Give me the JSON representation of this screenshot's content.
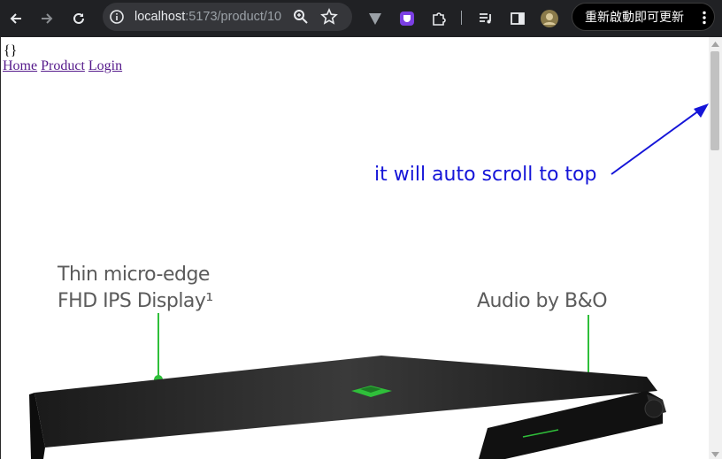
{
  "browser": {
    "url_host": "localhost",
    "url_path": ":5173/product/10",
    "update_button_label": "重新啟動即可更新",
    "icons": [
      "back-icon",
      "forward-icon",
      "reload-icon",
      "site-info-icon",
      "zoom-icon",
      "bookmark-star-icon",
      "extension-v-icon",
      "extension-shield-icon",
      "extensions-puzzle-icon",
      "media-queue-icon",
      "side-panel-icon",
      "profile-avatar-icon",
      "more-menu-icon"
    ]
  },
  "page": {
    "state_text": "{}",
    "nav": {
      "home": "Home",
      "product": "Product",
      "login": "Login"
    },
    "annotation": "it will auto scroll to top",
    "annotation_color": "#1515d8",
    "product_callouts": {
      "display_line1": "Thin micro-edge",
      "display_line2": "FHD IPS Display¹",
      "audio": "Audio by B&O"
    },
    "accent_color": "#2fbf3a"
  }
}
